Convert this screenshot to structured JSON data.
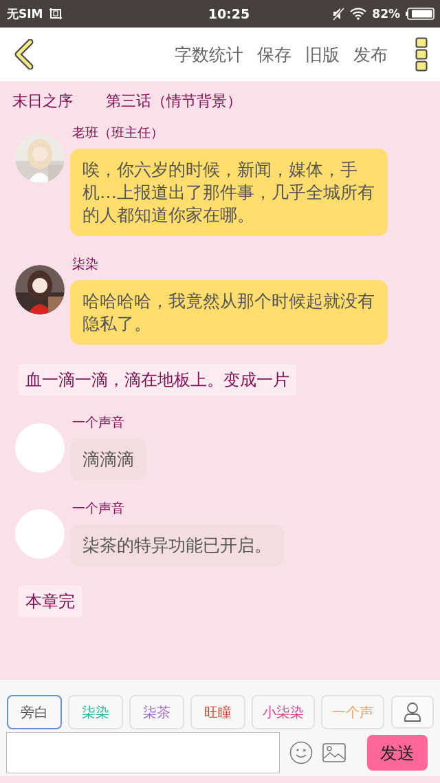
{
  "status_bar": {
    "carrier": "无SIM",
    "time": "10:25",
    "battery": "82%"
  },
  "header": {
    "actions": [
      "字数统计",
      "保存",
      "旧版",
      "发布"
    ]
  },
  "story": {
    "book": "末日之序",
    "chapter": "第三话（情节背景）"
  },
  "messages": [
    {
      "kind": "dialogue",
      "speaker": "老班（班主任）",
      "text": "唉，你六岁的时候，新闻，媒体，手机…上报道出了那件事，几乎全城所有的人都知道你家在哪。",
      "color": "#ffde6e"
    },
    {
      "kind": "dialogue",
      "speaker": "柒染",
      "text": "哈哈哈哈，我竟然从那个时候起就没有隐私了。",
      "color": "#ffde6e"
    },
    {
      "kind": "narration",
      "text": "血一滴一滴，滴在地板上。变成一片"
    },
    {
      "kind": "dialogue",
      "avatar": {
        "kind": "blank"
      },
      "speaker": "一个声音",
      "text": "滴滴滴",
      "color": "#f3dde0"
    },
    {
      "kind": "dialogue",
      "avatar": {
        "kind": "blank"
      },
      "speaker": "一个声音",
      "text": "柒茶的特异功能已开启。",
      "color": "#f3dde0"
    },
    {
      "kind": "narration",
      "text": "本章完"
    }
  ],
  "roles": [
    {
      "label": "旁白",
      "color": "#555555",
      "selected": true
    },
    {
      "label": "柒染",
      "color": "#2fb59a",
      "selected": false
    },
    {
      "label": "柒茶",
      "color": "#a06ad0",
      "selected": false
    },
    {
      "label": "旺瞳",
      "color": "#d9442e",
      "selected": false
    },
    {
      "label": "小柒染",
      "color": "#d8448c",
      "selected": false
    },
    {
      "label": "一个声",
      "color": "#f0a060",
      "selected": false
    }
  ],
  "composer": {
    "send": "发送"
  }
}
